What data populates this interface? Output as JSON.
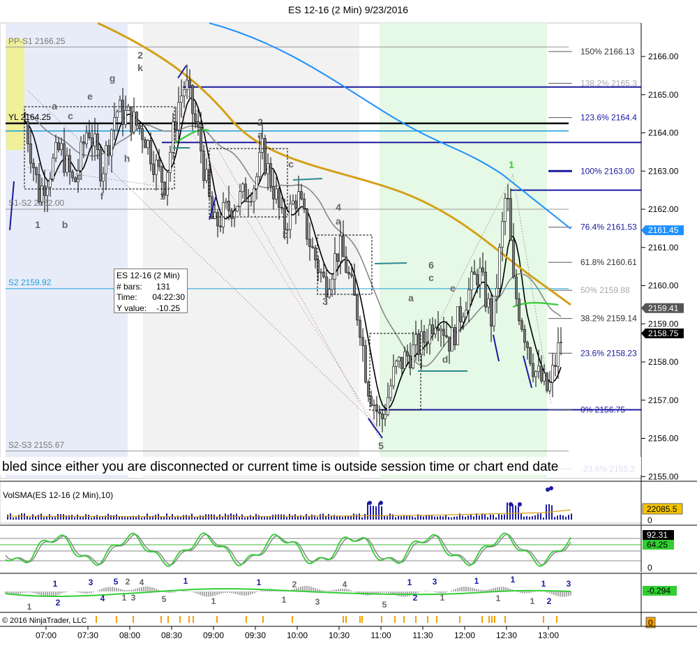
{
  "title": "ES 12-16 (2 Min)  9/23/2016",
  "footer": "© 2016 NinjaTrader, LLC",
  "banner": "bled since either you are disconnected or current time is outside session time or chart end date",
  "price_axis": [
    "2166.00",
    "2165.00",
    "2164.00",
    "2163.00",
    "2162.00",
    "2161.00",
    "2160.00",
    "2159.00",
    "2158.00",
    "2157.00",
    "2156.00",
    "2155.00"
  ],
  "time_axis": [
    "07:00",
    "07:30",
    "08:00",
    "08:30",
    "09:00",
    "09:30",
    "10:00",
    "10:30",
    "11:00",
    "11:30",
    "12:00",
    "12:30",
    "13:00"
  ],
  "pivot_labels": {
    "pp_s1": "PP-S1 2166.25",
    "yl": "YL 2164.25",
    "s1_s2": "S1-S2 2162.00",
    "s2": "S2 2159.92",
    "s2_s3": "S2-S3 2155.67"
  },
  "fib_labels": [
    {
      "pct": "150%",
      "val": "2166.13"
    },
    {
      "pct": "138.2%",
      "val": "2165.3"
    },
    {
      "pct": "123.6%",
      "val": "2164.4"
    },
    {
      "pct": "100%",
      "val": "2163.00"
    },
    {
      "pct": "76.4%",
      "val": "2161.53"
    },
    {
      "pct": "61.8%",
      "val": "2160.61"
    },
    {
      "pct": "50%",
      "val": "2159.88"
    },
    {
      "pct": "38.2%",
      "val": "2159.14"
    },
    {
      "pct": "23.6%",
      "val": "2158.23"
    },
    {
      "pct": "0%",
      "val": "2156.75"
    },
    {
      "pct": "-23.6%",
      "val": "2155.2"
    }
  ],
  "price_tags": [
    {
      "value": "2161.45",
      "color": "#1e90ff"
    },
    {
      "value": "2159.41",
      "color": "#555555"
    },
    {
      "value": "2158.75",
      "color": "#000000"
    }
  ],
  "info_box": {
    "instrument": "ES 12-16 (2 Min)",
    "bars_label": "# bars:",
    "bars_value": "131",
    "time_label": "Time:",
    "time_value": "04:22:30",
    "y_label": "Y value:",
    "y_value": "-10.25"
  },
  "volume_panel": {
    "label": "VolSMA(ES 12-16 (2 Min),10)",
    "tag": "22085.5",
    "zero": "0"
  },
  "stoch_panel": {
    "tag1": "92.31",
    "tag2": "64.25",
    "zero": "0"
  },
  "macd_panel": {
    "tag": "-0.294"
  },
  "bottom_panel": {
    "tag": "0"
  },
  "wave_labels": [
    {
      "t": "1",
      "x": 54,
      "y": 327
    },
    {
      "t": "b",
      "x": 93,
      "y": 327
    },
    {
      "t": "a",
      "x": 78,
      "y": 157
    },
    {
      "t": "c",
      "x": 101,
      "y": 171
    },
    {
      "t": "e",
      "x": 129,
      "y": 143
    },
    {
      "t": "d",
      "x": 114,
      "y": 258
    },
    {
      "t": "f",
      "x": 146,
      "y": 286
    },
    {
      "t": "g",
      "x": 161,
      "y": 117
    },
    {
      "t": "h",
      "x": 182,
      "y": 232
    },
    {
      "t": "2",
      "x": 201,
      "y": 84
    },
    {
      "t": "k",
      "x": 201,
      "y": 102
    },
    {
      "t": "1",
      "x": 233,
      "y": 286
    },
    {
      "t": "2",
      "x": 373,
      "y": 180
    },
    {
      "t": "a",
      "x": 373,
      "y": 198
    },
    {
      "t": "c",
      "x": 417,
      "y": 240
    },
    {
      "t": "b",
      "x": 409,
      "y": 341
    },
    {
      "t": "4",
      "x": 485,
      "y": 302
    },
    {
      "t": "a",
      "x": 485,
      "y": 322
    },
    {
      "t": "3",
      "x": 466,
      "y": 437
    },
    {
      "t": "6",
      "x": 618,
      "y": 385
    },
    {
      "t": "c",
      "x": 618,
      "y": 403
    },
    {
      "t": "a",
      "x": 589,
      "y": 432
    },
    {
      "t": "e",
      "x": 649,
      "y": 418
    },
    {
      "t": "d",
      "x": 638,
      "y": 520
    },
    {
      "t": "5",
      "x": 546,
      "y": 644
    }
  ],
  "wave_labels_blue": [
    {
      "t": "1",
      "x": 733,
      "y": 241
    }
  ],
  "osc_labels": [
    {
      "t": "1",
      "x": 79,
      "y": 841
    },
    {
      "t": "3",
      "x": 130,
      "y": 839
    },
    {
      "t": "5",
      "x": 166,
      "y": 838
    },
    {
      "t": "2",
      "x": 183,
      "y": 838
    },
    {
      "t": "4",
      "x": 203,
      "y": 839
    },
    {
      "t": "1",
      "x": 266,
      "y": 837
    },
    {
      "t": "1",
      "x": 371,
      "y": 839
    },
    {
      "t": "2",
      "x": 422,
      "y": 842
    },
    {
      "t": "4",
      "x": 494,
      "y": 842
    },
    {
      "t": "1",
      "x": 587,
      "y": 839
    },
    {
      "t": "3",
      "x": 623,
      "y": 838
    },
    {
      "t": "1",
      "x": 683,
      "y": 837
    },
    {
      "t": "1",
      "x": 735,
      "y": 835
    },
    {
      "t": "1",
      "x": 779,
      "y": 841
    },
    {
      "t": "3",
      "x": 815,
      "y": 841
    },
    {
      "t": "2",
      "x": 83,
      "y": 868
    },
    {
      "t": "4",
      "x": 147,
      "y": 862
    },
    {
      "t": "1",
      "x": 178,
      "y": 861
    },
    {
      "t": "3",
      "x": 191,
      "y": 861
    },
    {
      "t": "5",
      "x": 235,
      "y": 863
    },
    {
      "t": "1",
      "x": 306,
      "y": 866
    },
    {
      "t": "1",
      "x": 407,
      "y": 864
    },
    {
      "t": "3",
      "x": 455,
      "y": 867
    },
    {
      "t": "5",
      "x": 551,
      "y": 871
    },
    {
      "t": "2",
      "x": 595,
      "y": 861
    },
    {
      "t": "1",
      "x": 634,
      "y": 861
    },
    {
      "t": "1",
      "x": 714,
      "y": 862
    },
    {
      "t": "1",
      "x": 763,
      "y": 866
    },
    {
      "t": "2",
      "x": 787,
      "y": 866
    },
    {
      "t": "1",
      "x": 42,
      "y": 874
    }
  ],
  "chart_data": {
    "type": "candlestick",
    "title": "ES 12-16 (2 Min)  9/23/2016",
    "ylim": [
      2155.0,
      2166.6
    ],
    "x_ticks": [
      "07:00",
      "07:30",
      "08:00",
      "08:30",
      "09:00",
      "09:30",
      "10:00",
      "10:30",
      "11:00",
      "11:30",
      "12:00",
      "12:30",
      "13:00"
    ],
    "close_path": [
      [
        "06:45",
        2164.3
      ],
      [
        "06:55",
        2162.4
      ],
      [
        "07:00",
        2162.8
      ],
      [
        "07:10",
        2163.6
      ],
      [
        "07:20",
        2162.6
      ],
      [
        "07:30",
        2164.2
      ],
      [
        "07:40",
        2163.0
      ],
      [
        "07:50",
        2164.6
      ],
      [
        "08:00",
        2164.4
      ],
      [
        "08:10",
        2164.0
      ],
      [
        "08:20",
        2163.0
      ],
      [
        "08:25",
        2162.7
      ],
      [
        "08:35",
        2164.8
      ],
      [
        "08:40",
        2165.3
      ],
      [
        "08:50",
        2163.8
      ],
      [
        "09:00",
        2161.5
      ],
      [
        "09:10",
        2162.0
      ],
      [
        "09:20",
        2162.3
      ],
      [
        "09:30",
        2162.7
      ],
      [
        "09:35",
        2163.5
      ],
      [
        "09:45",
        2162.3
      ],
      [
        "09:50",
        2161.5
      ],
      [
        "10:00",
        2162.4
      ],
      [
        "10:10",
        2161.0
      ],
      [
        "10:20",
        2160.0
      ],
      [
        "10:30",
        2161.0
      ],
      [
        "10:35",
        2160.5
      ],
      [
        "10:45",
        2159.0
      ],
      [
        "10:50",
        2157.5
      ],
      [
        "11:00",
        2156.4
      ],
      [
        "11:10",
        2157.8
      ],
      [
        "11:20",
        2158.2
      ],
      [
        "11:30",
        2158.5
      ],
      [
        "11:40",
        2159.3
      ],
      [
        "11:50",
        2158.5
      ],
      [
        "12:00",
        2159.6
      ],
      [
        "12:10",
        2160.4
      ],
      [
        "12:20",
        2159.0
      ],
      [
        "12:30",
        2162.6
      ],
      [
        "12:35",
        2160.0
      ],
      [
        "12:40",
        2159.2
      ],
      [
        "12:50",
        2157.8
      ],
      [
        "13:00",
        2157.2
      ],
      [
        "13:05",
        2158.0
      ],
      [
        "13:10",
        2158.75
      ]
    ],
    "series": [
      {
        "name": "EMA fast",
        "color": "#000000"
      },
      {
        "name": "SMA mid",
        "color": "#808080"
      },
      {
        "name": "SMA slow",
        "color": "#d4a017"
      },
      {
        "name": "SMA long",
        "color": "#1e90ff"
      }
    ],
    "fib_levels": [
      {
        "pct": 150,
        "price": 2166.13
      },
      {
        "pct": 138.2,
        "price": 2165.3
      },
      {
        "pct": 123.6,
        "price": 2164.4
      },
      {
        "pct": 100,
        "price": 2163.0
      },
      {
        "pct": 76.4,
        "price": 2161.53
      },
      {
        "pct": 61.8,
        "price": 2160.61
      },
      {
        "pct": 50,
        "price": 2159.88
      },
      {
        "pct": 38.2,
        "price": 2159.14
      },
      {
        "pct": 23.6,
        "price": 2158.23
      },
      {
        "pct": 0,
        "price": 2156.75
      },
      {
        "pct": -23.6,
        "price": 2155.2
      }
    ],
    "pivot_levels": [
      {
        "name": "PP-S1",
        "price": 2166.25
      },
      {
        "name": "YL",
        "price": 2164.25
      },
      {
        "name": "S1-S2",
        "price": 2162.0
      },
      {
        "name": "S2",
        "price": 2159.92
      },
      {
        "name": "S2-S3",
        "price": 2155.67
      }
    ],
    "last_price": 2158.75
  }
}
